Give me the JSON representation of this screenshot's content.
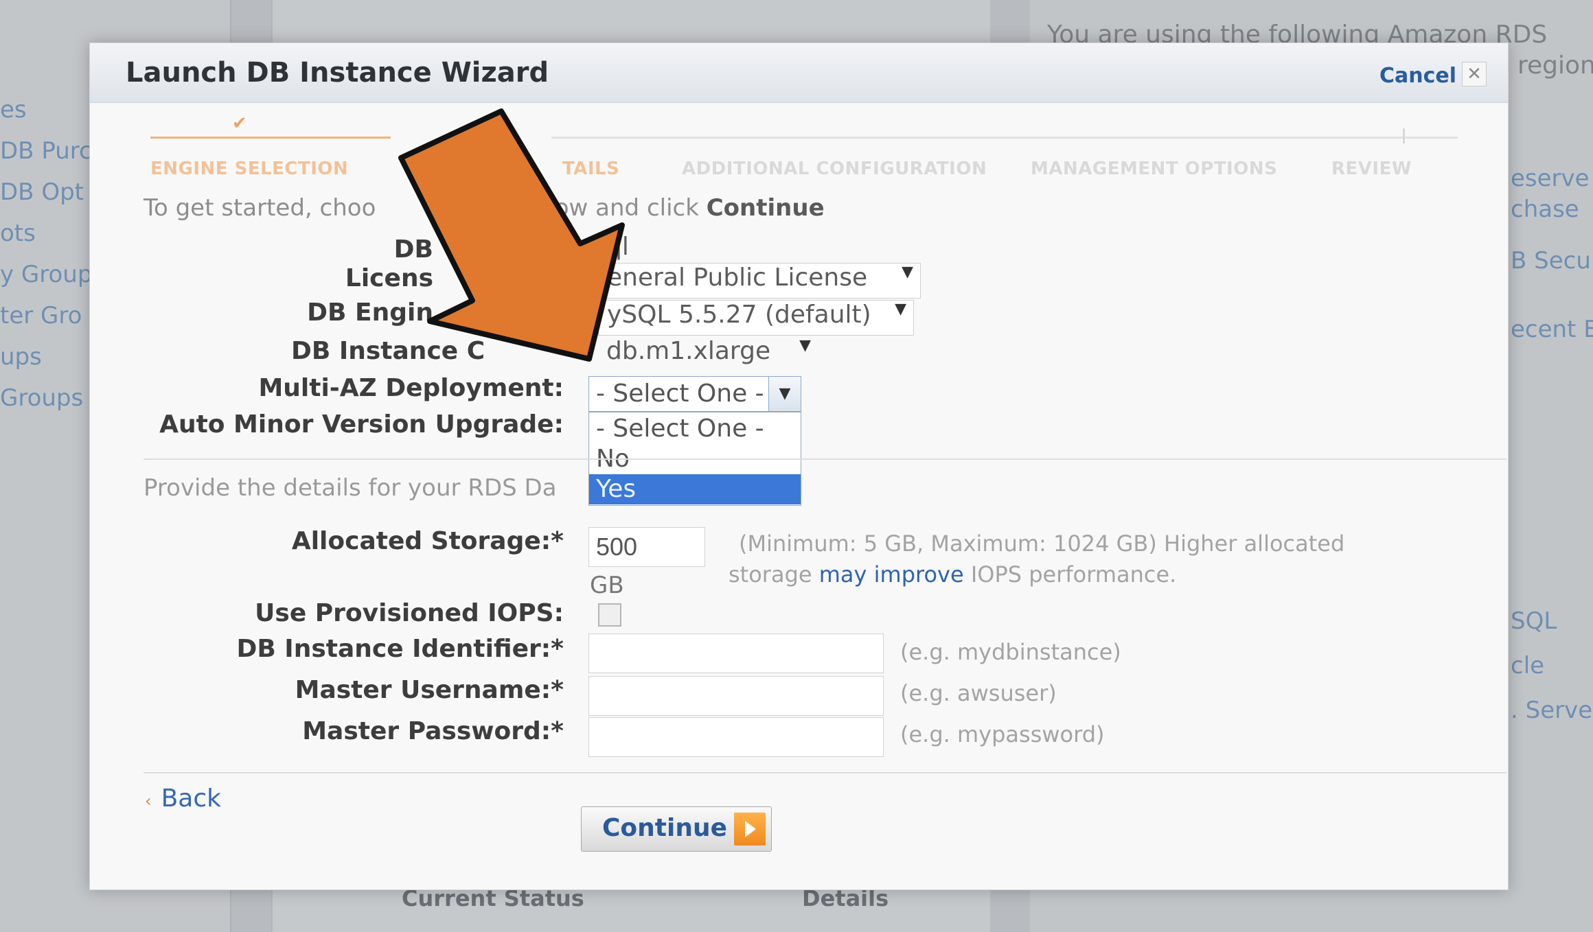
{
  "background": {
    "left_nav": [
      "es",
      "DB Purc",
      "DB Opt",
      "ots",
      "y Group",
      "ter Gro",
      "ups",
      "Groups"
    ],
    "right_text": [
      "You are using the following Amazon RDS",
      "region"
    ],
    "right_links": [
      "eserve",
      "chase",
      "B Secu",
      "ecent E",
      "SQL",
      "cle",
      ". Serve"
    ],
    "status_headers": [
      "Current Status",
      "Details"
    ]
  },
  "modal": {
    "title": "Launch DB Instance Wizard",
    "cancel_label": "Cancel",
    "close_glyph": "✕",
    "steps": [
      {
        "label": "ENGINE SELECTION",
        "state": "completed"
      },
      {
        "label": "TAILS",
        "state": "active"
      },
      {
        "label": "ADDITIONAL CONFIGURATION",
        "state": "pending"
      },
      {
        "label": "MANAGEMENT OPTIONS",
        "state": "pending"
      },
      {
        "label": "REVIEW",
        "state": "pending"
      }
    ],
    "intro_prefix": "To get started, choo",
    "intro_middle": "elow and click",
    "intro_bold": "Continue",
    "fields": {
      "db_engine": {
        "label": "DB",
        "value": "ql"
      },
      "license": {
        "label": "Licens",
        "value": "eneral Public License"
      },
      "engine_version": {
        "label": "DB Engin",
        "value": "ySQL 5.5.27 (default)"
      },
      "instance_class": {
        "label": "DB Instance C",
        "value": "db.m1.xlarge"
      },
      "multi_az": {
        "label": "Multi-AZ Deployment:",
        "value": "- Select One -",
        "options": [
          "- Select One -",
          "No",
          "Yes"
        ],
        "highlighted": "Yes"
      },
      "auto_minor": {
        "label": "Auto Minor Version Upgrade:"
      }
    },
    "provide_text": "Provide the details for your RDS Da",
    "storage": {
      "label": "Allocated Storage:*",
      "value": "500",
      "unit": "GB",
      "hint_prefix": "(Minimum: 5 GB, Maximum: 1024 GB) Higher allocated",
      "hint_line2_prefix": "storage",
      "hint_link": "may improve",
      "hint_suffix": "IOPS performance."
    },
    "iops": {
      "label": "Use Provisioned IOPS:",
      "checked": false
    },
    "identifier": {
      "label": "DB Instance Identifier:*",
      "value": "",
      "hint": "(e.g. mydbinstance)"
    },
    "username": {
      "label": "Master Username:*",
      "value": "",
      "hint": "(e.g. awsuser)"
    },
    "password": {
      "label": "Master Password:*",
      "value": "",
      "hint": "(e.g. mypassword)"
    },
    "back_label": "Back",
    "continue_label": "Continue"
  },
  "colors": {
    "arrow_fill": "#e0782e",
    "arrow_stroke": "#111111",
    "highlight": "#3b78d8",
    "link": "#2e63b0"
  }
}
